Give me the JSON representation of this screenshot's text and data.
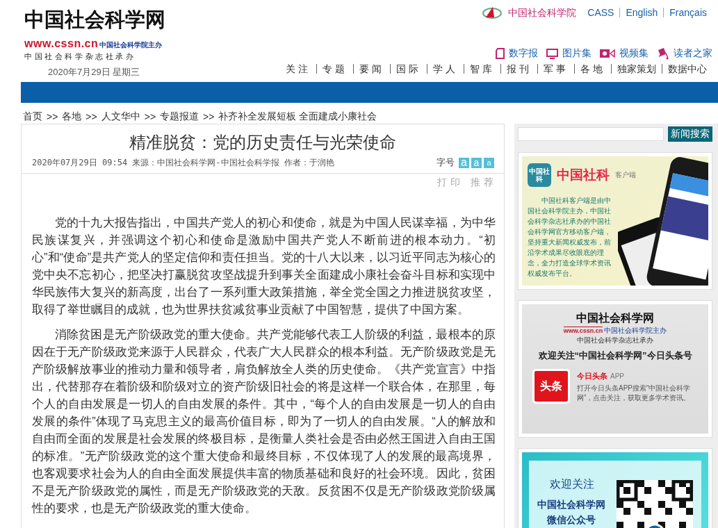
{
  "header": {
    "logo": {
      "title": "中国社会科学网",
      "url": "www.cssn.cn",
      "sponsor": "中国社会科学院主办",
      "publisher": "中国社会科学杂志社承办"
    },
    "date": "2020年7月29日 星期三",
    "top_links": [
      {
        "label": "中国社会科学院",
        "kind": "institute"
      },
      {
        "label": "CASS",
        "kind": "language"
      },
      {
        "label": "English",
        "kind": "language"
      },
      {
        "label": "Français",
        "kind": "language"
      }
    ],
    "media_links": [
      {
        "label": "数字报",
        "kind": "paper"
      },
      {
        "label": "图片集",
        "kind": "photo"
      },
      {
        "label": "视频集",
        "kind": "video"
      },
      {
        "label": "读者之家",
        "kind": "reader"
      }
    ],
    "nav": [
      "关注",
      "专题",
      "要闻",
      "国际",
      "学人",
      "智库",
      "报刊",
      "军事",
      "各地",
      "独家策划",
      "数据中心"
    ]
  },
  "breadcrumb": {
    "separator": ">>",
    "items": [
      "首页",
      "各地",
      "人文华中",
      "专题报道",
      "补齐补全发展短板 全面建成小康社会"
    ]
  },
  "article": {
    "title": "精准脱贫：党的历史责任与光荣使命",
    "meta": "2020年07月29日 09:54 来源：中国社会科学网-中国社会科学报 作者：于润艳",
    "font_size_label": "字号",
    "font_sizes": [
      "a",
      "a",
      "a"
    ],
    "actions": [
      "打印",
      "推荐"
    ],
    "paragraphs": [
      "党的十九大报告指出，中国共产党人的初心和使命，就是为中国人民谋幸福，为中华民族谋复兴，并强调这个初心和使命是激励中国共产党人不断前进的根本动力。“初心”和“使命”是共产党人的坚定信仰和责任担当。党的十八大以来，以习近平同志为核心的党中央不忘初心，把坚决打赢脱贫攻坚战提升到事关全面建成小康社会奋斗目标和实现中华民族伟大复兴的新高度，出台了一系列重大政策措施，举全党全国之力推进脱贫攻坚，取得了举世瞩目的成就，也为世界扶贫减贫事业贡献了中国智慧，提供了中国方案。",
      "消除贫困是无产阶级政党的重大使命。共产党能够代表工人阶级的利益，最根本的原因在于无产阶级政党来源于人民群众，代表广大人民群众的根本利益。无产阶级政党是无产阶级解放事业的推动力量和领导者，肩负解放全人类的历史使命。《共产党宣言》中指出，代替那存在着阶级和阶级对立的资产阶级旧社会的将是这样一个联合体，在那里，每个人的自由发展是一切人的自由发展的条件。其中，“每个人的自由发展是一切人的自由发展的条件”体现了马克思主义的最高价值目标，即为了一切人的自由发展。“人的解放和自由而全面的发展是社会发展的终极目标，是衡量人类社会是否由必然王国进入自由王国的标准。”无产阶级政党的这个重大使命和最终目标，不仅体现了人的发展的最高境界，也客观要求社会为人的自由全面发展提供丰富的物质基础和良好的社会环境。因此，贫困不是无产阶级政党的属性，而是无产阶级政党的天敌。反贫困不仅是无产阶级政党阶级属性的要求，也是无产阶级政党的重大使命。"
    ]
  },
  "sidebar": {
    "search": {
      "button": "新闻搜索"
    },
    "banners": [
      {
        "kind": "app",
        "icon_text": "中国社科",
        "title": "中国社科",
        "subtitle": "客户端",
        "text": "中国社科客户端是由中国社会科学院主办，中国社会科学杂志社承办的中国社会科学网官方移动客户端，坚持重大新闻权威发布，前沿学术成果尽收眼底的理念，全力打造全球学术资讯权威发布平台。"
      },
      {
        "kind": "toutiao",
        "logo": "中国社会科学网",
        "url": "www.cssn.cn",
        "sponsor": "中国社会科学院主办",
        "publisher": "中国社会科学杂志社承办",
        "title": "欢迎关注“中国社会科学网”今日头条号",
        "icon_text": "头条",
        "app_name": "今日头条",
        "app_tag": "APP",
        "text": "打开今日头条APP搜索“中国社会科学网”，点击关注，获取更多学术资讯。"
      },
      {
        "kind": "wechat",
        "title": "欢迎关注",
        "name": "中国社会科学网",
        "subtitle": "微信公众号"
      }
    ]
  }
}
